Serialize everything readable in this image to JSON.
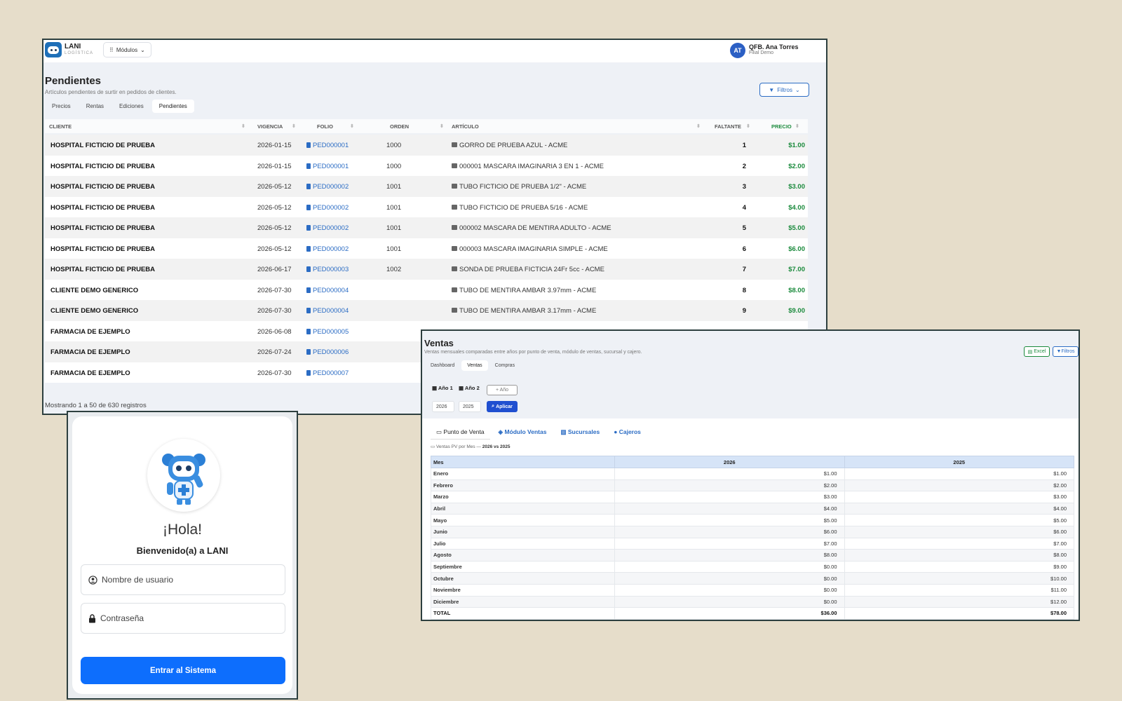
{
  "pendientes": {
    "brand": "LANI",
    "brand_sub": "LOGÍSTICA",
    "modules_label": "Módulos",
    "user": {
      "initials": "AT",
      "name": "QFB. Ana Torres",
      "branch": "Filial Demo"
    },
    "title": "Pendientes",
    "subtitle": "Artículos pendientes de surtir en pedidos de clientes.",
    "filters_label": "Filtros",
    "tabs": [
      "Precios",
      "Rentas",
      "Ediciones",
      "Pendientes"
    ],
    "columns": {
      "cliente": "CLIENTE",
      "vigencia": "VIGENCIA",
      "folio": "FOLIO",
      "orden": "ORDEN",
      "articulo": "ARTÍCULO",
      "faltante": "FALTANTE",
      "precio": "PRECIO"
    },
    "rows": [
      {
        "cliente": "HOSPITAL FICTICIO DE PRUEBA",
        "vigencia": "2026-01-15",
        "folio": "PED000001",
        "orden": "1000",
        "articulo": "GORRO DE PRUEBA AZUL - ACME",
        "faltante": "1",
        "precio": "$1.00"
      },
      {
        "cliente": "HOSPITAL FICTICIO DE PRUEBA",
        "vigencia": "2026-01-15",
        "folio": "PED000001",
        "orden": "1000",
        "articulo": "000001 MASCARA IMAGINARIA 3 EN 1 - ACME",
        "faltante": "2",
        "precio": "$2.00"
      },
      {
        "cliente": "HOSPITAL FICTICIO DE PRUEBA",
        "vigencia": "2026-05-12",
        "folio": "PED000002",
        "orden": "1001",
        "articulo": "TUBO FICTICIO DE PRUEBA 1/2\" - ACME",
        "faltante": "3",
        "precio": "$3.00"
      },
      {
        "cliente": "HOSPITAL FICTICIO DE PRUEBA",
        "vigencia": "2026-05-12",
        "folio": "PED000002",
        "orden": "1001",
        "articulo": "TUBO FICTICIO DE PRUEBA 5/16 - ACME",
        "faltante": "4",
        "precio": "$4.00"
      },
      {
        "cliente": "HOSPITAL FICTICIO DE PRUEBA",
        "vigencia": "2026-05-12",
        "folio": "PED000002",
        "orden": "1001",
        "articulo": "000002 MASCARA DE MENTIRA ADULTO - ACME",
        "faltante": "5",
        "precio": "$5.00"
      },
      {
        "cliente": "HOSPITAL FICTICIO DE PRUEBA",
        "vigencia": "2026-05-12",
        "folio": "PED000002",
        "orden": "1001",
        "articulo": "000003 MASCARA IMAGINARIA SIMPLE - ACME",
        "faltante": "6",
        "precio": "$6.00"
      },
      {
        "cliente": "HOSPITAL FICTICIO DE PRUEBA",
        "vigencia": "2026-06-17",
        "folio": "PED000003",
        "orden": "1002",
        "articulo": "SONDA DE PRUEBA FICTICIA 24Fr 5cc - ACME",
        "faltante": "7",
        "precio": "$7.00"
      },
      {
        "cliente": "CLIENTE DEMO GENERICO",
        "vigencia": "2026-07-30",
        "folio": "PED000004",
        "orden": "",
        "articulo": "TUBO DE MENTIRA AMBAR 3.97mm - ACME",
        "faltante": "8",
        "precio": "$8.00"
      },
      {
        "cliente": "CLIENTE DEMO GENERICO",
        "vigencia": "2026-07-30",
        "folio": "PED000004",
        "orden": "",
        "articulo": "TUBO DE MENTIRA AMBAR 3.17mm - ACME",
        "faltante": "9",
        "precio": "$9.00"
      },
      {
        "cliente": "FARMACIA DE EJEMPLO",
        "vigencia": "2026-06-08",
        "folio": "PED000005",
        "orden": "",
        "articulo": "",
        "faltante": "",
        "precio": ""
      },
      {
        "cliente": "FARMACIA DE EJEMPLO",
        "vigencia": "2026-07-24",
        "folio": "PED000006",
        "orden": "",
        "articulo": "",
        "faltante": "",
        "precio": ""
      },
      {
        "cliente": "FARMACIA DE EJEMPLO",
        "vigencia": "2026-07-30",
        "folio": "PED000007",
        "orden": "",
        "articulo": "",
        "faltante": "",
        "precio": ""
      }
    ],
    "footer": "Mostrando 1 a 50 de 630 registros"
  },
  "login": {
    "greeting": "¡Hola!",
    "welcome": "Bienvenido(a) a LANI",
    "username_placeholder": "Nombre de usuario",
    "password_placeholder": "Contraseña",
    "submit_label": "Entrar al Sistema",
    "icons": {
      "user": "user-circle-icon",
      "password": "lock-icon"
    }
  },
  "ventas": {
    "title": "Ventas",
    "subtitle": "Ventas mensuales comparadas entre años por punto de venta, módulo de ventas, sucursal y cajero.",
    "tabs": [
      "Dashboard",
      "Ventas",
      "Compras"
    ],
    "excel_label": "Excel",
    "filters_label": "Filtros",
    "year1_label": "Año 1",
    "year2_label": "Año 2",
    "add_year_label": "+ Año",
    "year1_value": "2026",
    "year2_value": "2025",
    "apply_label": "Aplicar",
    "subtabs": [
      "Punto de Venta",
      "Módulo Ventas",
      "Sucursales",
      "Cajeros"
    ],
    "caption_prefix": "Ventas PV por Mes —",
    "caption_years": "2026 vs 2025",
    "table": {
      "headers": [
        "Mes",
        "2026",
        "2025"
      ],
      "rows": [
        [
          "Enero",
          "$1.00",
          "$1.00"
        ],
        [
          "Febrero",
          "$2.00",
          "$2.00"
        ],
        [
          "Marzo",
          "$3.00",
          "$3.00"
        ],
        [
          "Abril",
          "$4.00",
          "$4.00"
        ],
        [
          "Mayo",
          "$5.00",
          "$5.00"
        ],
        [
          "Junio",
          "$6.00",
          "$6.00"
        ],
        [
          "Julio",
          "$7.00",
          "$7.00"
        ],
        [
          "Agosto",
          "$8.00",
          "$8.00"
        ],
        [
          "Septiembre",
          "$0.00",
          "$9.00"
        ],
        [
          "Octubre",
          "$0.00",
          "$10.00"
        ],
        [
          "Noviembre",
          "$0.00",
          "$11.00"
        ],
        [
          "Diciembre",
          "$0.00",
          "$12.00"
        ]
      ],
      "total": [
        "TOTAL",
        "$36.00",
        "$78.00"
      ]
    }
  },
  "colors": {
    "accent": "#2b6cc4",
    "price_green": "#1a8a3c",
    "login_button": "#0d6efd",
    "background": "#e6ddca"
  }
}
